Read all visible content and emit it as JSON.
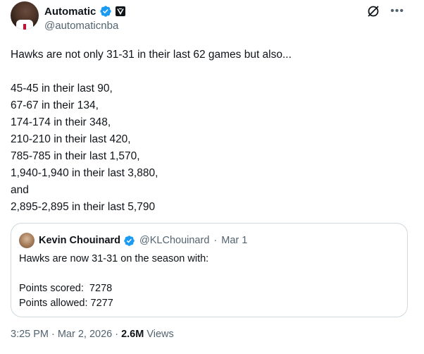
{
  "author": {
    "name": "Automatic",
    "handle": "@automaticnba"
  },
  "tweet": {
    "lines": [
      "Hawks are not only 31-31 in their last 62 games but also...",
      "",
      "45-45 in their last 90,",
      "67-67 in their 134,",
      "174-174 in their 348,",
      "210-210 in their last 420,",
      "785-785 in their last 1,570,",
      "1,940-1,940 in their last 3,880,",
      "and",
      "2,895-2,895 in their last 5,790"
    ]
  },
  "quote": {
    "name": "Kevin Chouinard",
    "handle": "@KLChouinard",
    "separator": "·",
    "date": "Mar 1",
    "line1": "Hawks are now 31-31 on the season with:",
    "line2": "Points scored:  7278",
    "line3": "Points allowed: 7277"
  },
  "meta": {
    "time": "3:25 PM",
    "sep1": "·",
    "date": "Mar 2, 2026",
    "sep2": "·",
    "views_count": "2.6M",
    "views_label": "Views"
  },
  "colors": {
    "verified": "#1d9bf0",
    "secondary_text": "#536471",
    "primary_text": "#0f1419",
    "border": "#cfd9de"
  },
  "icons": [
    "verified-badge-icon",
    "affiliate-badge-icon",
    "grok-icon",
    "more-icon"
  ]
}
